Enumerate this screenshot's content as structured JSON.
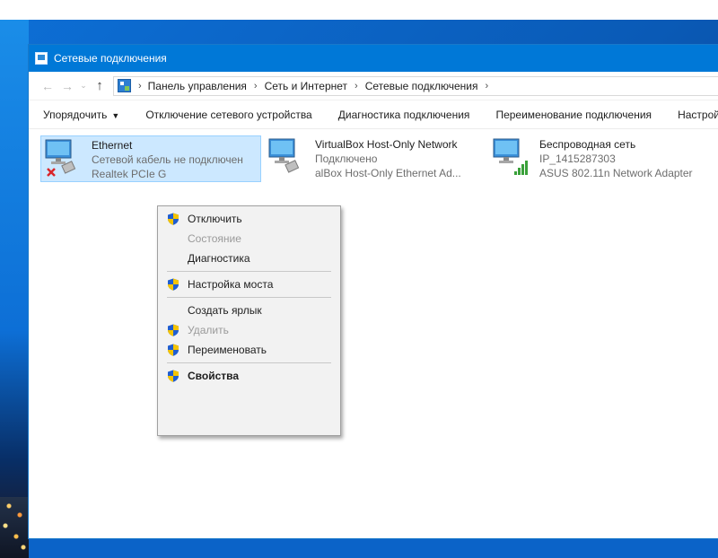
{
  "window": {
    "title": "Сетевые подключения"
  },
  "address": {
    "crumbs": [
      "Панель управления",
      "Сеть и Интернет",
      "Сетевые подключения"
    ],
    "separator": "›",
    "back_icon": "arrow-left-icon",
    "forward_icon": "arrow-right-icon",
    "up_icon": "arrow-up-icon"
  },
  "toolbar": {
    "items": [
      "Упорядочить",
      "Отключение сетевого устройства",
      "Диагностика подключения",
      "Переименование подключения",
      "Настрой"
    ],
    "dropdown_arrow": "▼"
  },
  "connections": [
    {
      "name": "Ethernet",
      "status": "Сетевой кабель не подключен",
      "adapter": "Realtek PCIe G",
      "selected": true,
      "icon": "ethernet-disconnected-icon"
    },
    {
      "name": "VirtualBox Host-Only Network",
      "status": "Подключено",
      "adapter": "alBox Host-Only Ethernet Ad...",
      "selected": false,
      "icon": "network-adapter-icon"
    },
    {
      "name": "Беспроводная сеть",
      "status": "IP_1415287303",
      "adapter": "ASUS 802.11n Network Adapter",
      "selected": false,
      "icon": "wireless-adapter-icon"
    }
  ],
  "context_menu": {
    "items": [
      {
        "label": "Отключить",
        "shield": true,
        "disabled": false,
        "bold": false
      },
      {
        "label": "Состояние",
        "shield": false,
        "disabled": true,
        "bold": false
      },
      {
        "label": "Диагностика",
        "shield": false,
        "disabled": false,
        "bold": false
      },
      {
        "label": "Настройка моста",
        "shield": true,
        "disabled": false,
        "bold": false
      },
      {
        "label": "Создать ярлык",
        "shield": false,
        "disabled": false,
        "bold": false
      },
      {
        "label": "Удалить",
        "shield": true,
        "disabled": true,
        "bold": false
      },
      {
        "label": "Переименовать",
        "shield": true,
        "disabled": false,
        "bold": false
      },
      {
        "label": "Свойства",
        "shield": true,
        "disabled": false,
        "bold": true
      }
    ]
  },
  "colors": {
    "titlebar": "#0078d7",
    "selection": "#cce8ff",
    "selection_border": "#99d1ff",
    "error": "#d9252a",
    "signal": "#3aa13a",
    "shield_blue": "#1f5ed1",
    "shield_yellow": "#f5c400"
  }
}
